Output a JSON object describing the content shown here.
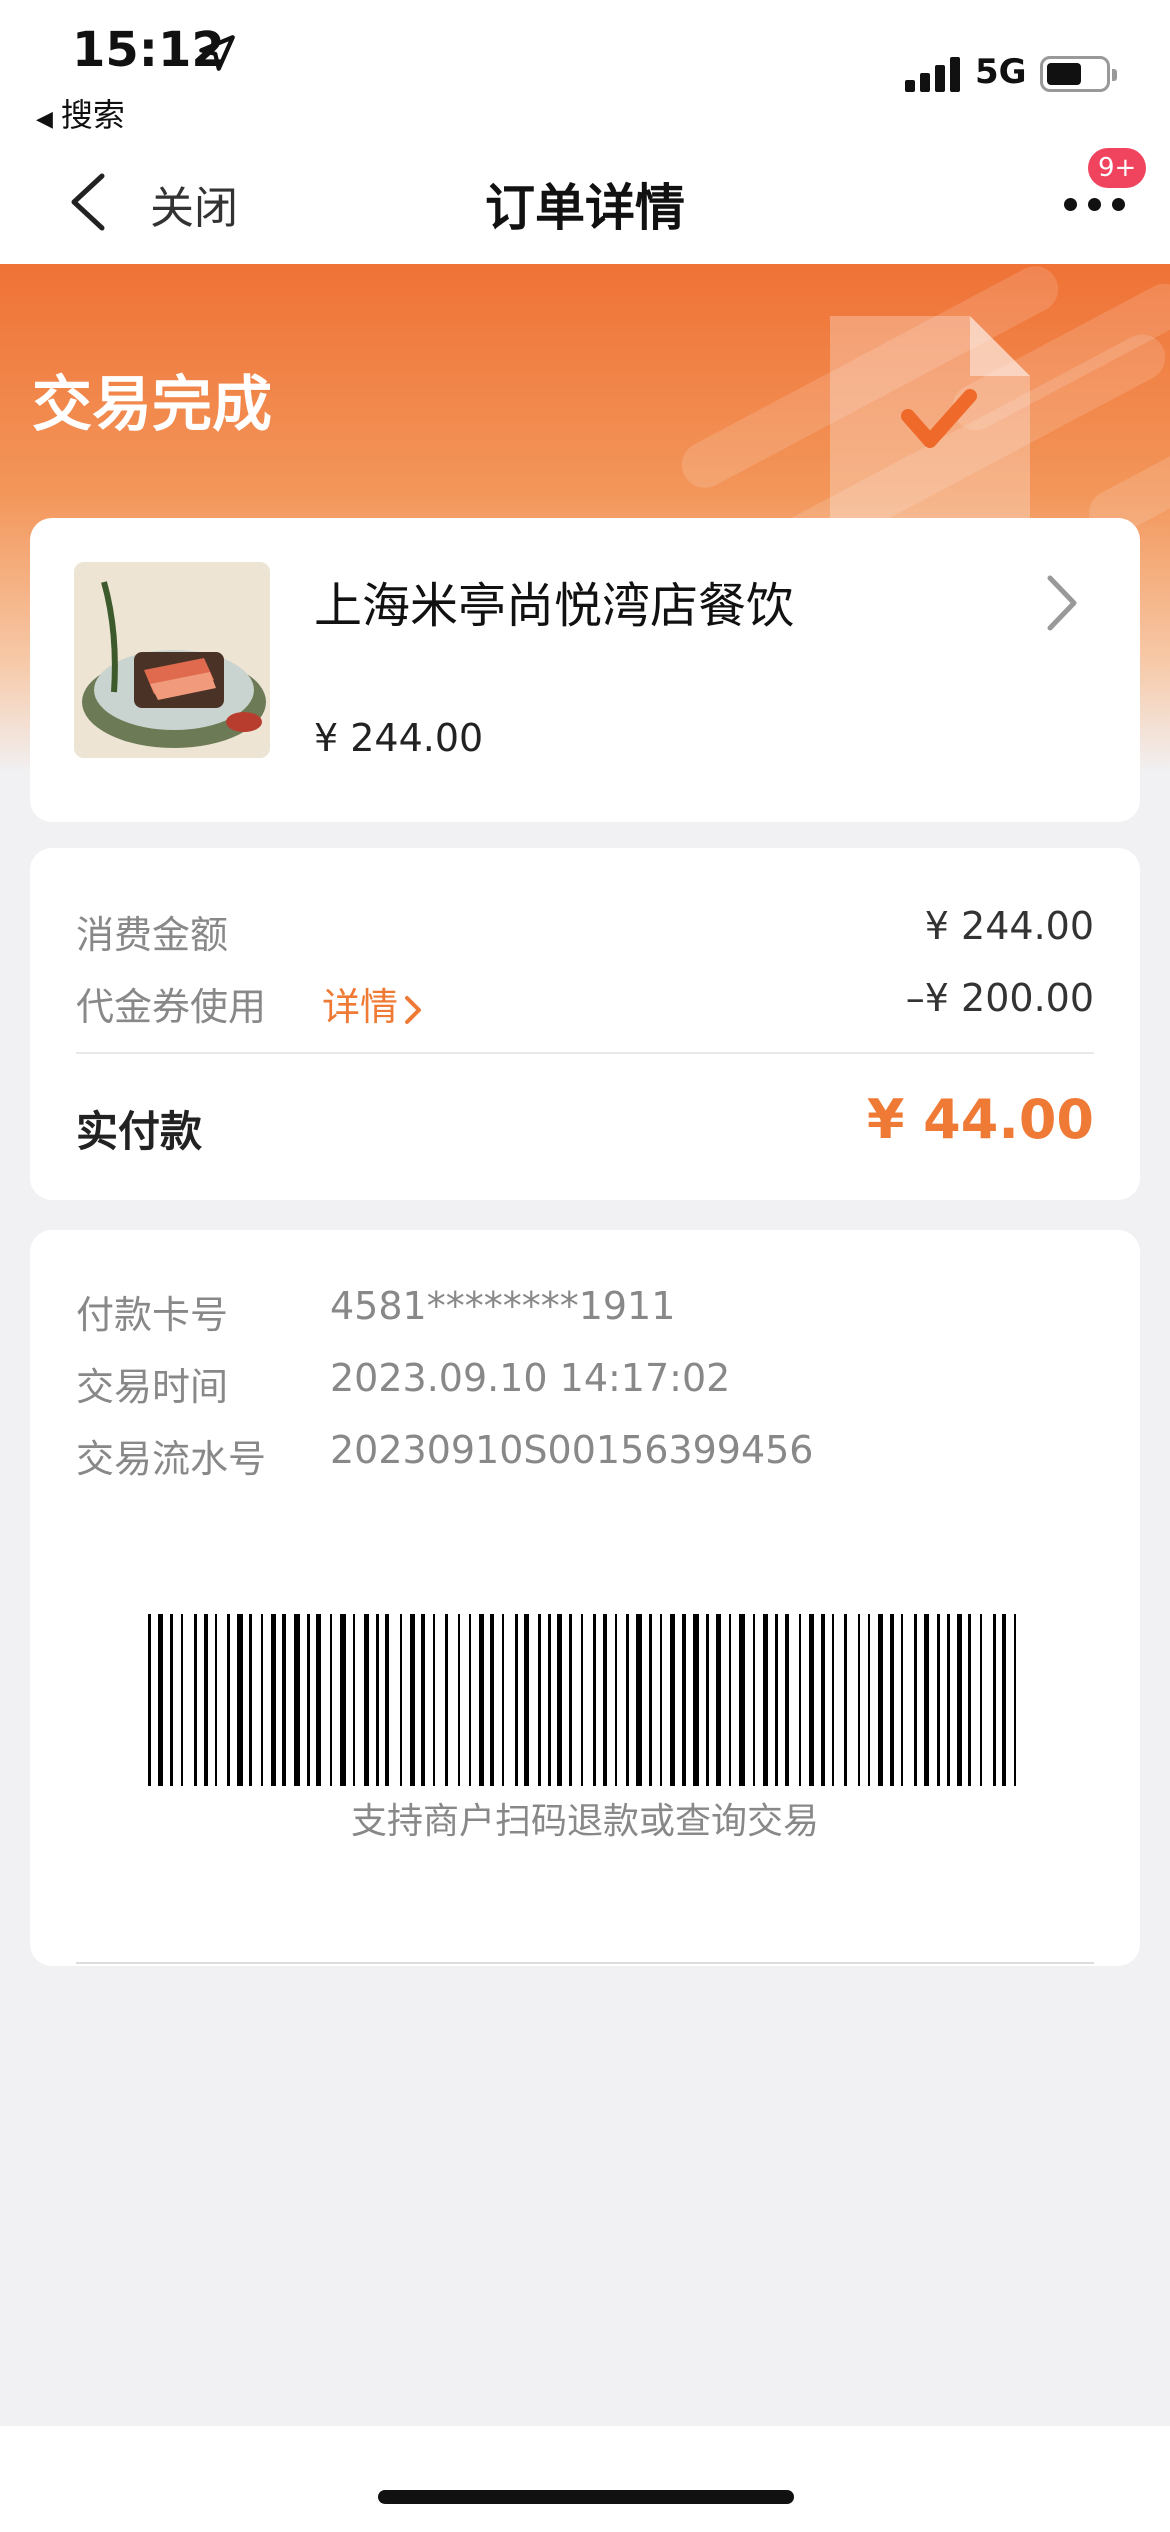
{
  "status_bar": {
    "time": "15:12",
    "back_app": "搜索",
    "network": "5G",
    "battery_level": 0.6
  },
  "nav": {
    "close_label": "关闭",
    "title": "订单详情",
    "badge": "9+"
  },
  "hero": {
    "title": "交易完成",
    "accent_color": "#ef7236"
  },
  "merchant": {
    "name": "上海米亭尚悦湾店餐饮",
    "price": "¥ 244.00"
  },
  "amounts": {
    "consume_label": "消费金额",
    "consume_value": "¥ 244.00",
    "coupon_label": "代金券使用",
    "coupon_link": "详情",
    "coupon_value": "–¥ 200.00",
    "paid_label": "实付款",
    "paid_value": "¥ 44.00"
  },
  "transaction": {
    "card_label": "付款卡号",
    "card_value": "4581********1911",
    "time_label": "交易时间",
    "time_value": "2023.09.10 14:17:02",
    "serial_label": "交易流水号",
    "serial_value": "20230910S00156399456",
    "barcode_note": "支持商户扫码退款或查询交易"
  }
}
